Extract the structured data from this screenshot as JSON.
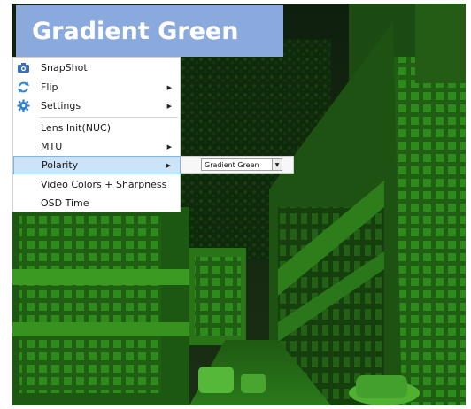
{
  "banner": {
    "title": "Gradient Green"
  },
  "menu": {
    "items": [
      {
        "label": "SnapShot",
        "icon": "camera-icon",
        "has_submenu": false
      },
      {
        "label": "Flip",
        "icon": "flip-icon",
        "has_submenu": true
      },
      {
        "label": "Settings",
        "icon": "gear-icon",
        "has_submenu": true
      },
      {
        "label": "Lens Init(NUC)",
        "has_submenu": false
      },
      {
        "label": "MTU",
        "has_submenu": true
      },
      {
        "label": "Polarity",
        "has_submenu": true,
        "highlighted": true
      },
      {
        "label": "Video Colors + Sharpness",
        "has_submenu": false
      },
      {
        "label": "OSD Time",
        "has_submenu": false
      }
    ]
  },
  "polarity": {
    "selected": "Gradient Green"
  },
  "colors": {
    "banner": "#8aa9dd",
    "highlight": "#cde3f7",
    "palette": "gradient-green"
  }
}
